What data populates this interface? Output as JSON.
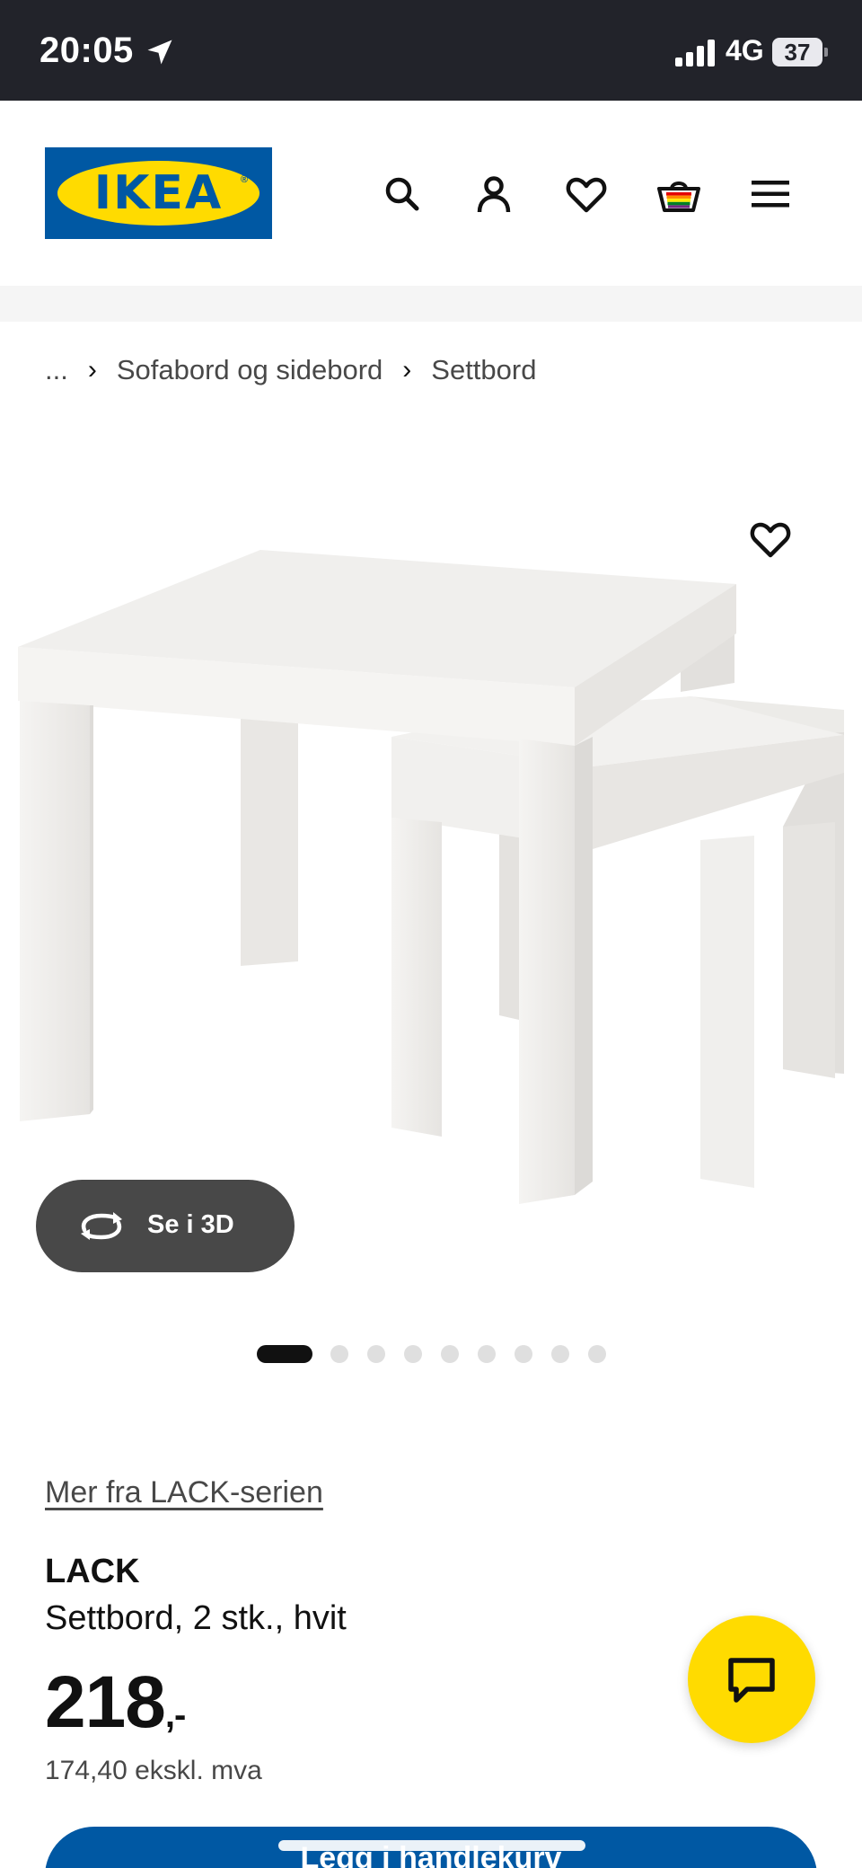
{
  "status_bar": {
    "time": "20:05",
    "network": "4G",
    "battery": "37",
    "icons": [
      "location-arrow-icon",
      "signal-icon",
      "battery-icon"
    ]
  },
  "header": {
    "logo_text": "IKEA",
    "logo_registered": "®",
    "icons": [
      "search-icon",
      "account-icon",
      "heart-icon",
      "cart-icon",
      "menu-icon"
    ],
    "brand_colors": {
      "blue": "#0058a3",
      "yellow": "#ffdb00"
    }
  },
  "breadcrumb": {
    "items": [
      "...",
      "Sofabord og sidebord",
      "Settbord"
    ],
    "separator": "›"
  },
  "gallery": {
    "view_3d_label": "Se i 3D",
    "dot_count": 9,
    "active_index": 0
  },
  "product": {
    "series_link": "Mer fra LACK-serien",
    "name": "LACK",
    "description": "Settbord, 2 stk., hvit",
    "price": "218",
    "price_suffix": ",-",
    "price_excl_vat": "174,40 ekskl. mva",
    "add_to_cart_label": "Legg i handlekurv"
  },
  "colors": {
    "status_bar_bg": "#22232a",
    "button_grey": "#484848",
    "chat_yellow": "#ffdb00",
    "cart_blue": "#0058a3"
  }
}
